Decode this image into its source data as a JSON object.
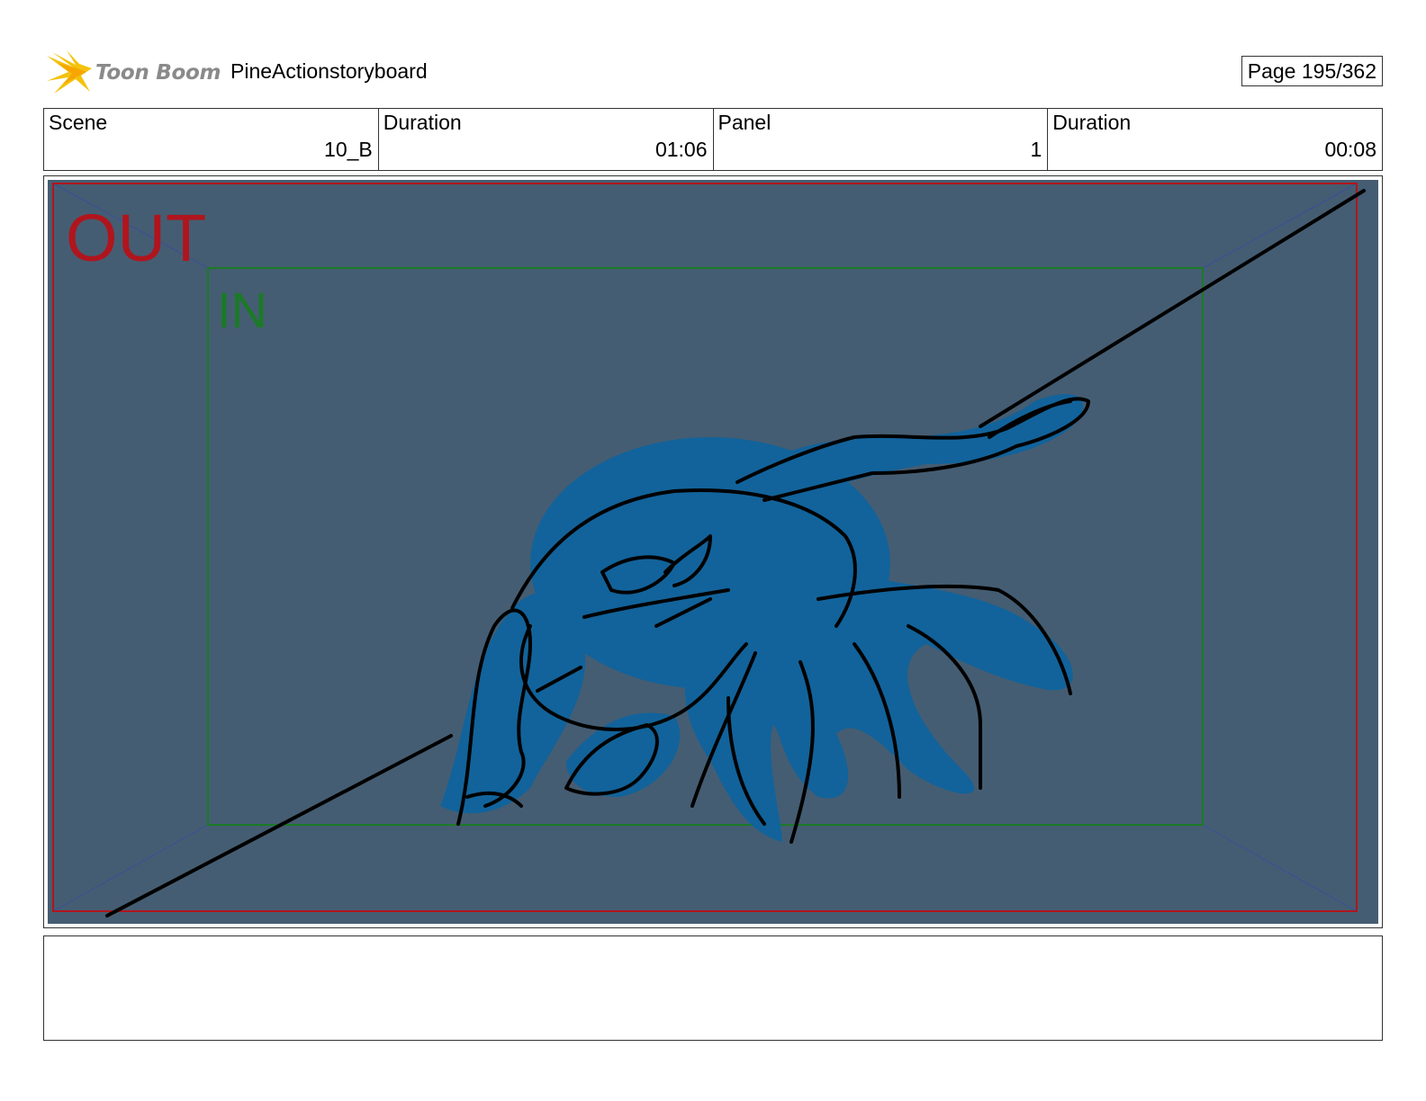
{
  "header": {
    "logo_text": "Toon Boom",
    "project_title": "PineActionstoryboard",
    "page_label": "Page 195/362"
  },
  "info": [
    {
      "label": "Scene",
      "value": "10_B"
    },
    {
      "label": "Duration",
      "value": "01:06"
    },
    {
      "label": "Panel",
      "value": "1"
    },
    {
      "label": "Duration",
      "value": "00:08"
    }
  ],
  "panel": {
    "out_label": "OUT",
    "in_label": "IN",
    "colors": {
      "background": "#455d72",
      "out_frame": "#b0151d",
      "in_frame": "#1b7a26",
      "creature_fill": "#12639b",
      "guide_lines": "#3a4f9a"
    }
  },
  "notes": {
    "text": ""
  }
}
